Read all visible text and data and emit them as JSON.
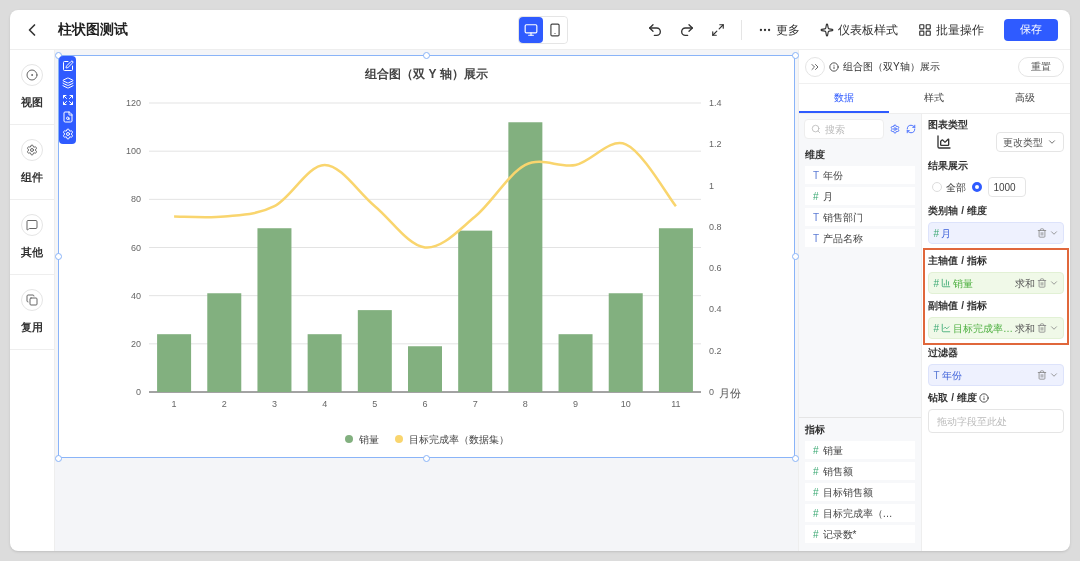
{
  "header": {
    "title": "柱状图测试",
    "devices": [
      {
        "kind": "desktop",
        "selected": true
      },
      {
        "kind": "mobile",
        "selected": false
      }
    ],
    "actions": [
      {
        "kind": "more",
        "label": "更多"
      },
      {
        "kind": "style",
        "label": "仪表板样式"
      },
      {
        "kind": "batch",
        "label": "批量操作"
      }
    ],
    "save": "保存"
  },
  "rail": [
    {
      "kind": "view",
      "label": "视图"
    },
    {
      "kind": "component",
      "label": "组件"
    },
    {
      "kind": "other",
      "label": "其他"
    },
    {
      "kind": "reuse",
      "label": "复用"
    }
  ],
  "chart": {
    "title": "组合图（双 Y 轴）展示",
    "chart_data": {
      "type": "bar",
      "xlabel": "月份",
      "categories": [
        "1",
        "2",
        "3",
        "4",
        "5",
        "6",
        "7",
        "8",
        "9",
        "10",
        "11"
      ],
      "series": [
        {
          "name": "销量",
          "color": "#82b07f",
          "type": "bar",
          "values": [
            24,
            41,
            68,
            24,
            34,
            19,
            67,
            112,
            24,
            41,
            68
          ]
        },
        {
          "name": "目标完成率（数据集）",
          "color": "#f9d56e",
          "type": "line",
          "axis": "y2",
          "values": [
            0.85,
            0.85,
            0.9,
            1.1,
            0.9,
            0.7,
            0.85,
            1.1,
            1.1,
            1.2,
            0.9
          ]
        }
      ],
      "grid": true,
      "ylim": [
        0,
        120
      ],
      "yticks": [
        0,
        20,
        40,
        60,
        80,
        100,
        120
      ],
      "y2lim": [
        0,
        1.4
      ],
      "y2ticks": [
        0,
        0.2,
        0.4,
        0.6,
        0.8,
        1,
        1.2,
        1.4
      ]
    }
  },
  "panel": {
    "title": "组合图（双Y轴）展示",
    "reset": "重置",
    "tabs": [
      {
        "label": "数据",
        "selected": true
      },
      {
        "label": "样式",
        "selected": false
      },
      {
        "label": "高级",
        "selected": false
      }
    ],
    "search": {
      "placeholder": "搜索"
    },
    "dimensions": {
      "title": "维度",
      "items": [
        {
          "glyph": "T",
          "kind": "text",
          "label": "年份"
        },
        {
          "glyph": "#",
          "kind": "number",
          "label": "月"
        },
        {
          "glyph": "T",
          "kind": "text",
          "label": "销售部门"
        },
        {
          "glyph": "T",
          "kind": "text",
          "label": "产品名称"
        }
      ]
    },
    "measures": {
      "title": "指标",
      "items": [
        {
          "glyph": "#",
          "kind": "number",
          "label": "销量"
        },
        {
          "glyph": "#",
          "kind": "number",
          "label": "销售额"
        },
        {
          "glyph": "#",
          "kind": "number",
          "label": "目标销售额"
        },
        {
          "glyph": "#",
          "kind": "number",
          "label": "目标完成率（…"
        },
        {
          "glyph": "#",
          "kind": "number",
          "label": "记录数*"
        }
      ]
    },
    "chart_type": {
      "title": "图表类型",
      "change": "更改类型"
    },
    "result": {
      "title": "结果展示",
      "all": {
        "label": "全部",
        "selected": false
      },
      "limit": {
        "selected": true,
        "value": "1000"
      }
    },
    "sections": [
      {
        "kind": "field",
        "title": "类别轴 / 维度",
        "highlighted": false,
        "field": {
          "kind": "dimension",
          "glyph": "#",
          "label": "月"
        }
      },
      {
        "kind": "field",
        "title": "主轴值 / 指标",
        "highlighted": true,
        "field": {
          "kind": "bar_measure",
          "glyph": "#",
          "label": "销量",
          "agg": "求和"
        }
      },
      {
        "kind": "field",
        "title": "副轴值 / 指标",
        "highlighted": true,
        "field": {
          "kind": "line_measure",
          "glyph": "#",
          "label": "目标完成率…",
          "agg": "求和"
        }
      },
      {
        "kind": "field",
        "title": "过滤器",
        "highlighted": false,
        "field": {
          "kind": "dimension",
          "glyph": "T",
          "label": "年份"
        }
      },
      {
        "kind": "drop",
        "title": "钻取 / 维度",
        "info": true,
        "placeholder": "拖动字段至此处"
      }
    ]
  }
}
